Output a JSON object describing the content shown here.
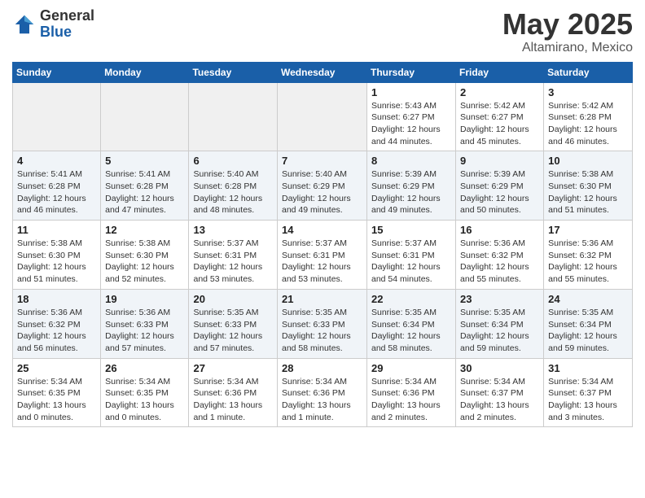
{
  "header": {
    "logo_general": "General",
    "logo_blue": "Blue",
    "month": "May 2025",
    "location": "Altamirano, Mexico"
  },
  "days_of_week": [
    "Sunday",
    "Monday",
    "Tuesday",
    "Wednesday",
    "Thursday",
    "Friday",
    "Saturday"
  ],
  "weeks": [
    {
      "row_class": "row-white",
      "days": [
        {
          "num": "",
          "info": "",
          "empty": true
        },
        {
          "num": "",
          "info": "",
          "empty": true
        },
        {
          "num": "",
          "info": "",
          "empty": true
        },
        {
          "num": "",
          "info": "",
          "empty": true
        },
        {
          "num": "1",
          "info": "Sunrise: 5:43 AM\nSunset: 6:27 PM\nDaylight: 12 hours\nand 44 minutes.",
          "empty": false
        },
        {
          "num": "2",
          "info": "Sunrise: 5:42 AM\nSunset: 6:27 PM\nDaylight: 12 hours\nand 45 minutes.",
          "empty": false
        },
        {
          "num": "3",
          "info": "Sunrise: 5:42 AM\nSunset: 6:28 PM\nDaylight: 12 hours\nand 46 minutes.",
          "empty": false
        }
      ]
    },
    {
      "row_class": "row-gray",
      "days": [
        {
          "num": "4",
          "info": "Sunrise: 5:41 AM\nSunset: 6:28 PM\nDaylight: 12 hours\nand 46 minutes.",
          "empty": false
        },
        {
          "num": "5",
          "info": "Sunrise: 5:41 AM\nSunset: 6:28 PM\nDaylight: 12 hours\nand 47 minutes.",
          "empty": false
        },
        {
          "num": "6",
          "info": "Sunrise: 5:40 AM\nSunset: 6:28 PM\nDaylight: 12 hours\nand 48 minutes.",
          "empty": false
        },
        {
          "num": "7",
          "info": "Sunrise: 5:40 AM\nSunset: 6:29 PM\nDaylight: 12 hours\nand 49 minutes.",
          "empty": false
        },
        {
          "num": "8",
          "info": "Sunrise: 5:39 AM\nSunset: 6:29 PM\nDaylight: 12 hours\nand 49 minutes.",
          "empty": false
        },
        {
          "num": "9",
          "info": "Sunrise: 5:39 AM\nSunset: 6:29 PM\nDaylight: 12 hours\nand 50 minutes.",
          "empty": false
        },
        {
          "num": "10",
          "info": "Sunrise: 5:38 AM\nSunset: 6:30 PM\nDaylight: 12 hours\nand 51 minutes.",
          "empty": false
        }
      ]
    },
    {
      "row_class": "row-white",
      "days": [
        {
          "num": "11",
          "info": "Sunrise: 5:38 AM\nSunset: 6:30 PM\nDaylight: 12 hours\nand 51 minutes.",
          "empty": false
        },
        {
          "num": "12",
          "info": "Sunrise: 5:38 AM\nSunset: 6:30 PM\nDaylight: 12 hours\nand 52 minutes.",
          "empty": false
        },
        {
          "num": "13",
          "info": "Sunrise: 5:37 AM\nSunset: 6:31 PM\nDaylight: 12 hours\nand 53 minutes.",
          "empty": false
        },
        {
          "num": "14",
          "info": "Sunrise: 5:37 AM\nSunset: 6:31 PM\nDaylight: 12 hours\nand 53 minutes.",
          "empty": false
        },
        {
          "num": "15",
          "info": "Sunrise: 5:37 AM\nSunset: 6:31 PM\nDaylight: 12 hours\nand 54 minutes.",
          "empty": false
        },
        {
          "num": "16",
          "info": "Sunrise: 5:36 AM\nSunset: 6:32 PM\nDaylight: 12 hours\nand 55 minutes.",
          "empty": false
        },
        {
          "num": "17",
          "info": "Sunrise: 5:36 AM\nSunset: 6:32 PM\nDaylight: 12 hours\nand 55 minutes.",
          "empty": false
        }
      ]
    },
    {
      "row_class": "row-gray",
      "days": [
        {
          "num": "18",
          "info": "Sunrise: 5:36 AM\nSunset: 6:32 PM\nDaylight: 12 hours\nand 56 minutes.",
          "empty": false
        },
        {
          "num": "19",
          "info": "Sunrise: 5:36 AM\nSunset: 6:33 PM\nDaylight: 12 hours\nand 57 minutes.",
          "empty": false
        },
        {
          "num": "20",
          "info": "Sunrise: 5:35 AM\nSunset: 6:33 PM\nDaylight: 12 hours\nand 57 minutes.",
          "empty": false
        },
        {
          "num": "21",
          "info": "Sunrise: 5:35 AM\nSunset: 6:33 PM\nDaylight: 12 hours\nand 58 minutes.",
          "empty": false
        },
        {
          "num": "22",
          "info": "Sunrise: 5:35 AM\nSunset: 6:34 PM\nDaylight: 12 hours\nand 58 minutes.",
          "empty": false
        },
        {
          "num": "23",
          "info": "Sunrise: 5:35 AM\nSunset: 6:34 PM\nDaylight: 12 hours\nand 59 minutes.",
          "empty": false
        },
        {
          "num": "24",
          "info": "Sunrise: 5:35 AM\nSunset: 6:34 PM\nDaylight: 12 hours\nand 59 minutes.",
          "empty": false
        }
      ]
    },
    {
      "row_class": "row-white",
      "days": [
        {
          "num": "25",
          "info": "Sunrise: 5:34 AM\nSunset: 6:35 PM\nDaylight: 13 hours\nand 0 minutes.",
          "empty": false
        },
        {
          "num": "26",
          "info": "Sunrise: 5:34 AM\nSunset: 6:35 PM\nDaylight: 13 hours\nand 0 minutes.",
          "empty": false
        },
        {
          "num": "27",
          "info": "Sunrise: 5:34 AM\nSunset: 6:36 PM\nDaylight: 13 hours\nand 1 minute.",
          "empty": false
        },
        {
          "num": "28",
          "info": "Sunrise: 5:34 AM\nSunset: 6:36 PM\nDaylight: 13 hours\nand 1 minute.",
          "empty": false
        },
        {
          "num": "29",
          "info": "Sunrise: 5:34 AM\nSunset: 6:36 PM\nDaylight: 13 hours\nand 2 minutes.",
          "empty": false
        },
        {
          "num": "30",
          "info": "Sunrise: 5:34 AM\nSunset: 6:37 PM\nDaylight: 13 hours\nand 2 minutes.",
          "empty": false
        },
        {
          "num": "31",
          "info": "Sunrise: 5:34 AM\nSunset: 6:37 PM\nDaylight: 13 hours\nand 3 minutes.",
          "empty": false
        }
      ]
    }
  ]
}
